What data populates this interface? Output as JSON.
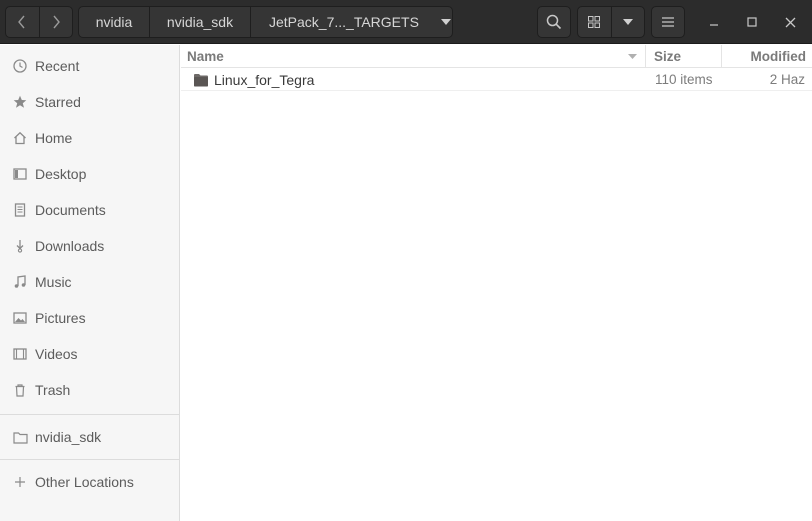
{
  "headerbar": {
    "path": [
      "nvidia",
      "nvidia_sdk",
      "JetPack_7..._TARGETS"
    ],
    "icons": {
      "back": "chevron-left-icon",
      "forward": "chevron-right-icon",
      "path_dropdown": "chevron-down-icon",
      "search": "search-icon",
      "view_grid": "grid-view-icon",
      "view_options": "chevron-down-icon",
      "menu": "hamburger-menu-icon",
      "minimize": "minimize-icon",
      "maximize": "maximize-icon",
      "close": "close-icon"
    }
  },
  "sidebar": {
    "items": [
      {
        "label": "Recent",
        "icon": "clock-icon"
      },
      {
        "label": "Starred",
        "icon": "star-icon"
      },
      {
        "label": "Home",
        "icon": "home-icon"
      },
      {
        "label": "Desktop",
        "icon": "desktop-icon"
      },
      {
        "label": "Documents",
        "icon": "document-icon"
      },
      {
        "label": "Downloads",
        "icon": "download-icon"
      },
      {
        "label": "Music",
        "icon": "music-icon"
      },
      {
        "label": "Pictures",
        "icon": "picture-icon"
      },
      {
        "label": "Videos",
        "icon": "video-icon"
      },
      {
        "label": "Trash",
        "icon": "trash-icon"
      }
    ],
    "bookmarks": [
      {
        "label": "nvidia_sdk",
        "icon": "folder-icon"
      }
    ],
    "other": {
      "label": "Other Locations",
      "icon": "plus-icon"
    }
  },
  "list": {
    "columns": {
      "name": "Name",
      "size": "Size",
      "modified": "Modified"
    },
    "rows": [
      {
        "name": "Linux_for_Tegra",
        "size": "110 items",
        "modified": "2 Haz",
        "icon": "folder-icon"
      }
    ]
  },
  "colors": {
    "headerbar": "#2c2c2c",
    "sidebar": "#f6f6f6",
    "folder": "#6e6a68"
  }
}
